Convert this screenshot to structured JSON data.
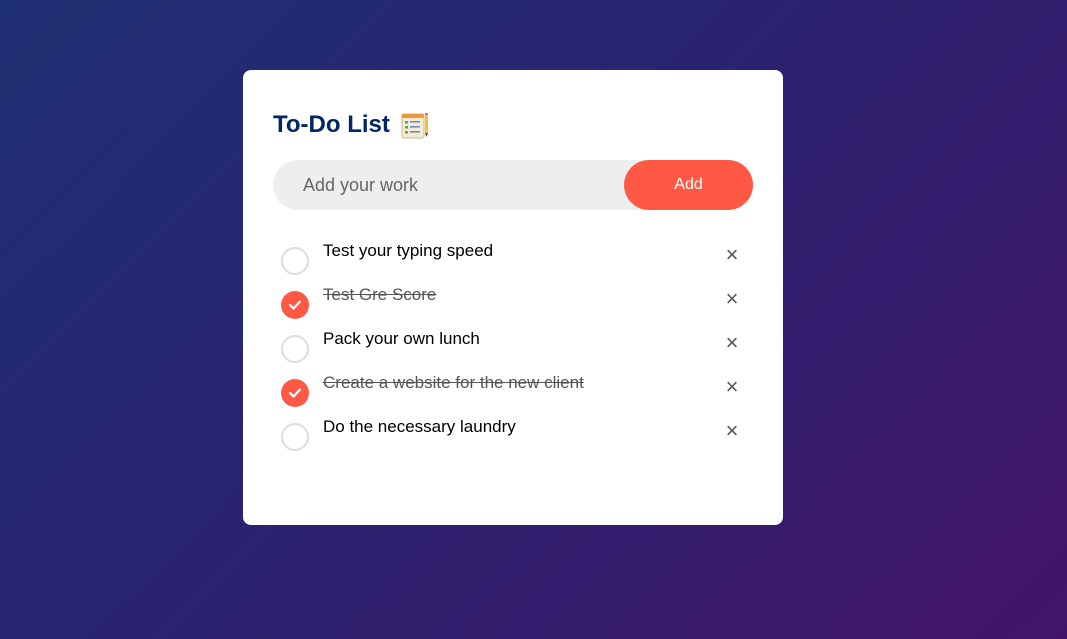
{
  "app": {
    "title": "To-Do List",
    "title_icon": "notepad-checklist-icon"
  },
  "input": {
    "placeholder": "Add your work",
    "value": "",
    "add_label": "Add"
  },
  "colors": {
    "accent": "#ff5945",
    "title": "#002765",
    "input_bg": "#edeef0"
  },
  "tasks": [
    {
      "text": "Test your typing speed",
      "checked": false
    },
    {
      "text": "Test Gre Score",
      "checked": true
    },
    {
      "text": "Pack your own lunch",
      "checked": false
    },
    {
      "text": "Create a website for the new client",
      "checked": true
    },
    {
      "text": "Do the necessary laundry",
      "checked": false
    }
  ],
  "remove_glyph": "×"
}
